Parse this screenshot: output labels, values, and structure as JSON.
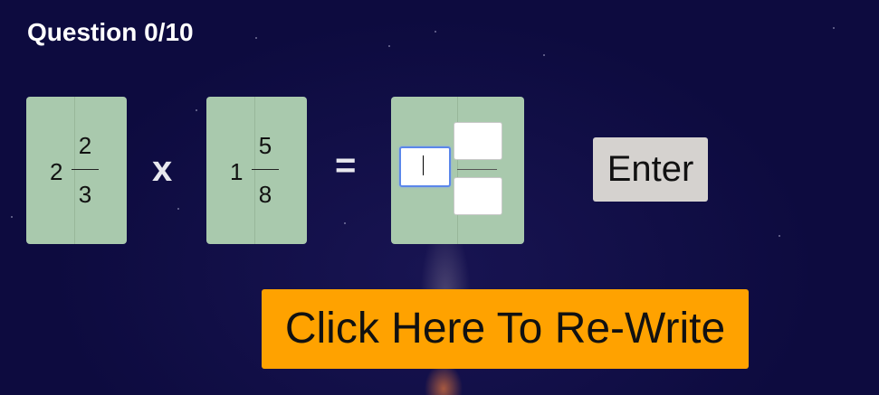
{
  "header": {
    "question_label": "Question 0/10"
  },
  "problem": {
    "first": {
      "whole": "2",
      "numerator": "2",
      "denominator": "3"
    },
    "operator": "x",
    "second": {
      "whole": "1",
      "numerator": "5",
      "denominator": "8"
    },
    "equals": "="
  },
  "answer": {
    "whole": "",
    "numerator": "",
    "denominator": ""
  },
  "buttons": {
    "enter_label": "Enter",
    "rewrite_label": "Click Here To Re-Write"
  },
  "colors": {
    "background": "#0d0b3f",
    "card": "#a9c9ad",
    "rewrite": "#ffa200",
    "enter": "#d5d2cf"
  }
}
